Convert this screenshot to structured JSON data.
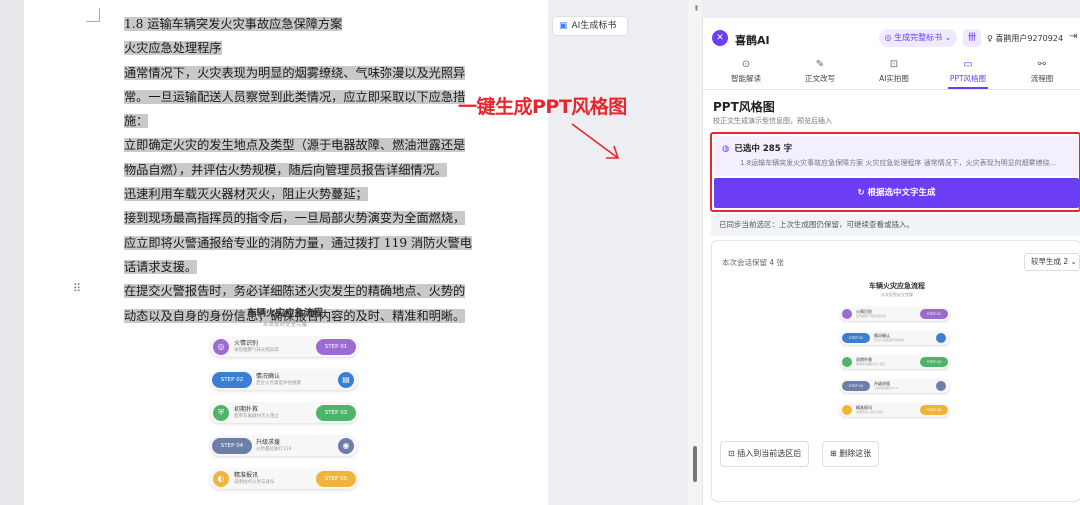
{
  "document": {
    "paragraphs": [
      {
        "text": "1.8 运输车辆突发火灾事故应急保障方案",
        "indent": true
      },
      {
        "text": "火灾应急处理程序",
        "indent": true
      },
      {
        "text": "通常情况下，火灾表现为明显的烟雾缭绕、气味弥漫以及光照异常。一旦运输配送人员察觉到此类情况，应立即采取以下应急措施：",
        "indent": true
      },
      {
        "text": "立即确定火灾的发生地点及类型（源于电器故障、燃油泄露还是物品自燃），并评估火势规模，随后向管理员报告详细情况。",
        "indent": true
      },
      {
        "text": "迅速利用车载灭火器材灭火，阻止火势蔓延；",
        "indent": true
      },
      {
        "text": "接到现场最高指挥员的指令后，一旦局部火势演变为全面燃烧，应立即将火警通报给专业的消防力量，通过拨打 119 消防火警电话请求支援。",
        "indent": true
      },
      {
        "text": "在提交火警报告时，务必详细陈述火灾发生的精确地点、火势的动态以及自身的身份信息，确保报告内容的及时、精准和明晰。",
        "indent": true
      }
    ],
    "drag_handle": "⠿"
  },
  "flowchart": {
    "title": "车辆火灾应急流程",
    "subtitle": "从发现到安全完履",
    "steps": [
      {
        "label": "火情识别",
        "desc": "发现烟雾气味光照异常",
        "step": "STEP 01",
        "color": "#9b6bd1",
        "icon": "◎"
      },
      {
        "label": "情况确认",
        "desc": "定位火点类型评估规模",
        "step": "STEP 02",
        "color": "#3b7fd4",
        "icon": "▤"
      },
      {
        "label": "初期扑救",
        "desc": "使用车载器材灭火阻止",
        "step": "STEP 03",
        "color": "#4fb36a",
        "icon": "⛨"
      },
      {
        "label": "升级求援",
        "desc": "火势蔓延拨打119",
        "step": "STEP 04",
        "color": "#6b7fa8",
        "icon": "◉"
      },
      {
        "label": "精准报讯",
        "desc": "说明地点火势与身份",
        "step": "STEP 05",
        "color": "#f0b43a",
        "icon": "◐"
      }
    ]
  },
  "ai_tab": {
    "label": "AI生成标书",
    "icon": "doc-ai-icon"
  },
  "annotation": {
    "text": "一键生成PPT风格图",
    "color": "#e8262d"
  },
  "panel": {
    "brand": "喜鹊AI",
    "gen_pill": "◎ 生成完整标书 ⌄",
    "gift_icon": "卌",
    "user": "♀ 喜鹊用户9270924",
    "exit_icon": "⇥",
    "tabs": [
      {
        "label": "智能解读",
        "icon": "⊙",
        "active": false
      },
      {
        "label": "正文改写",
        "icon": "✎",
        "active": false
      },
      {
        "label": "AI实拍图",
        "icon": "⊡",
        "active": false
      },
      {
        "label": "PPT风格图",
        "icon": "▭",
        "active": true
      },
      {
        "label": "流程图",
        "icon": "⚯",
        "active": false
      }
    ],
    "section_title": "PPT风格图",
    "section_sub": "校正文生成演示型信息图，预览后插入",
    "selection_count": "已选中 285 字",
    "selection_icon": "◍",
    "selection_preview": "1.8运输车辆突发火灾事故应急保障方案 火灾应急处理程序 通常情况下，火灾表现为明显的烟雾缭绕...",
    "generate_button": "↻ 根据选中文字生成",
    "sync_note": "已同步当前选区：上次生成图仍保留，可继续查看或插入。",
    "keep_note": "本次会话保留 4 张",
    "version_select": "较早生成 2 ⌄",
    "insert_button": "⊡ 插入到当前选区后",
    "delete_button": "⊞ 删除这张",
    "accent": "#6b3df5"
  }
}
